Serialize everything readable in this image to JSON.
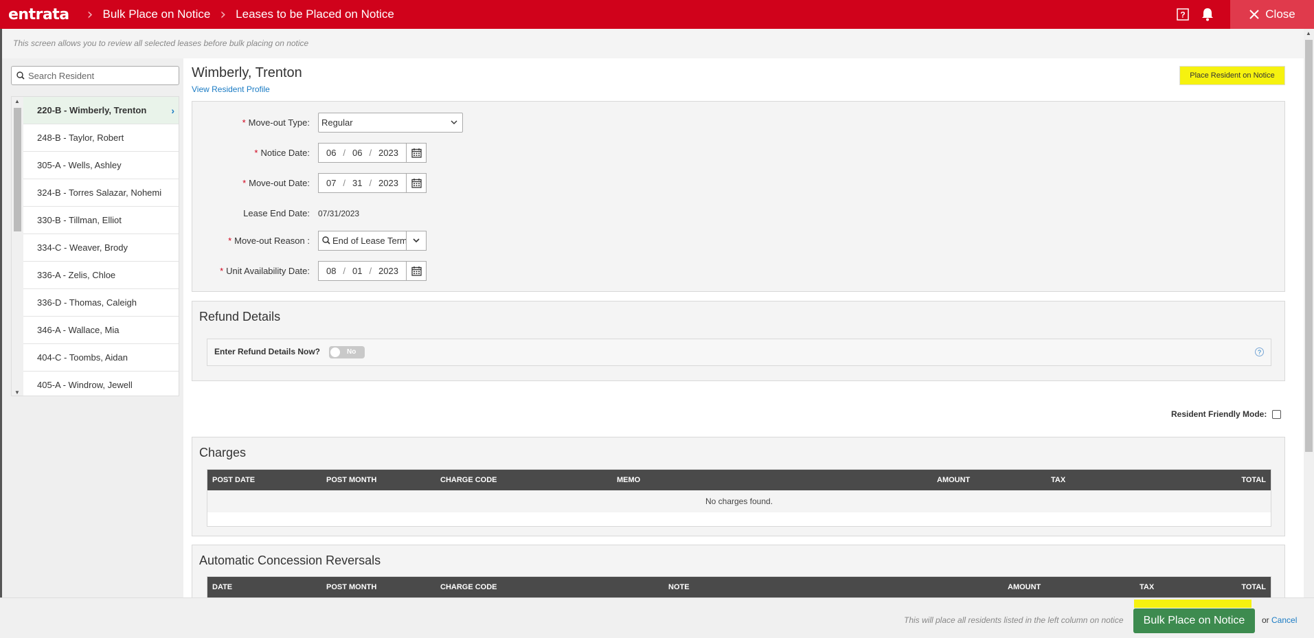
{
  "header": {
    "logo": "entrata",
    "breadcrumbs": [
      "Bulk Place on Notice",
      "Leases to be Placed on Notice"
    ],
    "close_label": "Close"
  },
  "info_text": "This screen allows you to review all selected leases before bulk placing on notice",
  "sidebar": {
    "search_placeholder": "Search Resident",
    "residents": [
      {
        "label": "220-B - Wimberly, Trenton",
        "active": true
      },
      {
        "label": "248-B - Taylor, Robert"
      },
      {
        "label": "305-A - Wells, Ashley"
      },
      {
        "label": "324-B - Torres Salazar, Nohemi"
      },
      {
        "label": "330-B - Tillman, Elliot"
      },
      {
        "label": "334-C - Weaver, Brody"
      },
      {
        "label": "336-A - Zelis, Chloe"
      },
      {
        "label": "336-D - Thomas, Caleigh"
      },
      {
        "label": "346-A - Wallace, Mia"
      },
      {
        "label": "404-C - Toombs, Aidan"
      },
      {
        "label": "405-A - Windrow, Jewell"
      }
    ]
  },
  "main": {
    "resident_name": "Wimberly, Trenton",
    "profile_link": "View Resident Profile",
    "place_button": "Place Resident on Notice",
    "form": {
      "move_out_type": {
        "label": "Move-out Type:",
        "value": "Regular"
      },
      "notice_date": {
        "label": "Notice Date:",
        "month": "06",
        "day": "06",
        "year": "2023"
      },
      "move_out_date": {
        "label": "Move-out Date:",
        "month": "07",
        "day": "31",
        "year": "2023"
      },
      "lease_end_date": {
        "label": "Lease End Date:",
        "value": "07/31/2023"
      },
      "move_out_reason": {
        "label": "Move-out Reason :",
        "value": "End of Lease Term"
      },
      "unit_availability_date": {
        "label": "Unit Availability Date:",
        "month": "08",
        "day": "01",
        "year": "2023"
      }
    },
    "refund": {
      "title": "Refund Details",
      "toggle_label": "Enter Refund Details Now?",
      "toggle_value": "No",
      "help": "?"
    },
    "resident_friendly_mode": "Resident Friendly Mode:",
    "charges": {
      "title": "Charges",
      "columns": [
        "POST DATE",
        "POST MONTH",
        "CHARGE CODE",
        "MEMO",
        "AMOUNT",
        "TAX",
        "TOTAL"
      ],
      "empty": "No charges found."
    },
    "concessions": {
      "title": "Automatic Concession Reversals",
      "columns": [
        "DATE",
        "POST MONTH",
        "CHARGE CODE",
        "NOTE",
        "AMOUNT",
        "TAX",
        "TOTAL"
      ]
    }
  },
  "footer": {
    "note": "This will place all residents listed in the left column on notice",
    "bulk_button": "Bulk Place on Notice",
    "or": "or",
    "cancel": "Cancel"
  },
  "colors": {
    "brand_red": "#d0021b",
    "highlight_yellow": "#f6f20f",
    "action_green": "#3d8b4f",
    "link_blue": "#1a7bc4"
  }
}
